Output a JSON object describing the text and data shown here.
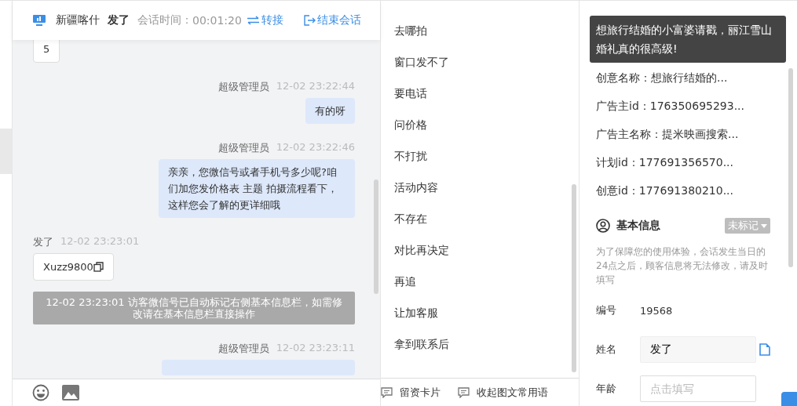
{
  "chat": {
    "header": {
      "channel": "新疆喀什",
      "visitor": "发了",
      "session_label": "会话时间：",
      "session_time": "00:01:20",
      "transfer": "转接",
      "end": "结束会话"
    },
    "messages": [
      {
        "kind": "visitor",
        "text": "5"
      },
      {
        "kind": "agent",
        "sender": "超级管理员",
        "time": "12-02 23:22:44",
        "text": "有的呀"
      },
      {
        "kind": "agent",
        "sender": "超级管理员",
        "time": "12-02 23:22:46",
        "text": "亲亲，您微信号或者手机号多少呢?咱们加您发价格表 主题 拍摄流程看下，这样您会了解的更详细哦"
      },
      {
        "kind": "visitor",
        "sender": "发了",
        "time": "12-02 23:23:01",
        "text": "Xuzz9800",
        "copy": true
      },
      {
        "kind": "system",
        "text": "12-02 23:23:01 访客微信号已自动标记右侧基本信息栏，如需修改请在基本信息栏直接操作"
      },
      {
        "kind": "agent",
        "sender": "超级管理员",
        "time": "12-02 23:23:11"
      }
    ]
  },
  "phrases": {
    "items": [
      "去哪拍",
      "窗口发不了",
      "要电话",
      "问价格",
      "不打扰",
      "活动内容",
      "不存在",
      "对比再决定",
      "再追",
      "让加客服",
      "拿到联系后"
    ],
    "footer": [
      "留资卡片",
      "收起图文常用语"
    ]
  },
  "info": {
    "tooltip": "想旅行结婚的小富婆请戳，丽江雪山婚礼真的很高级!",
    "ad_items": [
      "创意名称：想旅行结婚的...",
      "广告主id：176350695293...",
      "广告主名称：提米映画搜索...",
      "计划id：177691356570...",
      "创意id：177691380210..."
    ],
    "basic": {
      "title": "基本信息",
      "tag": "未标记",
      "notice": "为了保障您的使用体验，会话发生当日的24点之后，顾客信息将无法修改，请及时填写",
      "fields": [
        {
          "kind": "text",
          "label": "编号",
          "value": "19568"
        },
        {
          "kind": "filled",
          "label": "姓名",
          "value": "发了"
        },
        {
          "kind": "input",
          "label": "年龄",
          "placeholder": "点击填写"
        }
      ]
    }
  }
}
